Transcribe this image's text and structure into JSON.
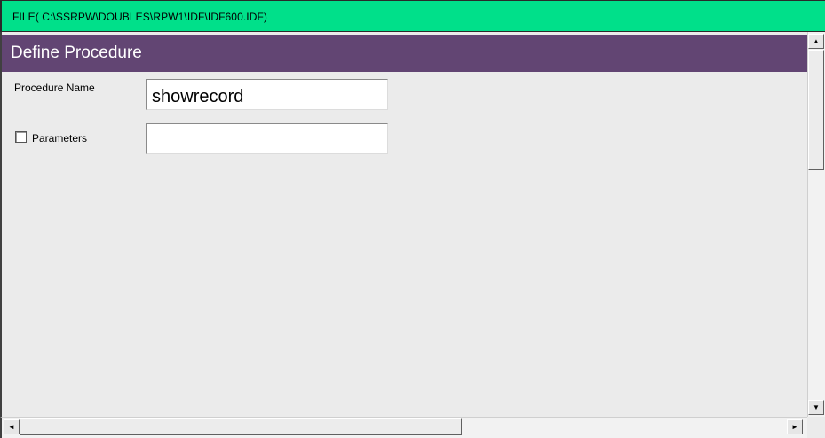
{
  "window": {
    "file_title": "FILE( C:\\SSRPW\\DOUBLES\\RPW1\\IDF\\IDF600.IDF)"
  },
  "form": {
    "header": "Define Procedure",
    "procedure_name": {
      "label": "Procedure Name",
      "value": "showrecord"
    },
    "parameters": {
      "label": "Parameters",
      "checked": false,
      "value": ""
    }
  },
  "scrollbars": {
    "up_arrow": "▲",
    "down_arrow": "▼",
    "left_arrow": "◄",
    "right_arrow": "►"
  },
  "colors": {
    "title_bar": "#00e08a",
    "header_band": "#624573",
    "panel_background": "#ebebeb"
  }
}
